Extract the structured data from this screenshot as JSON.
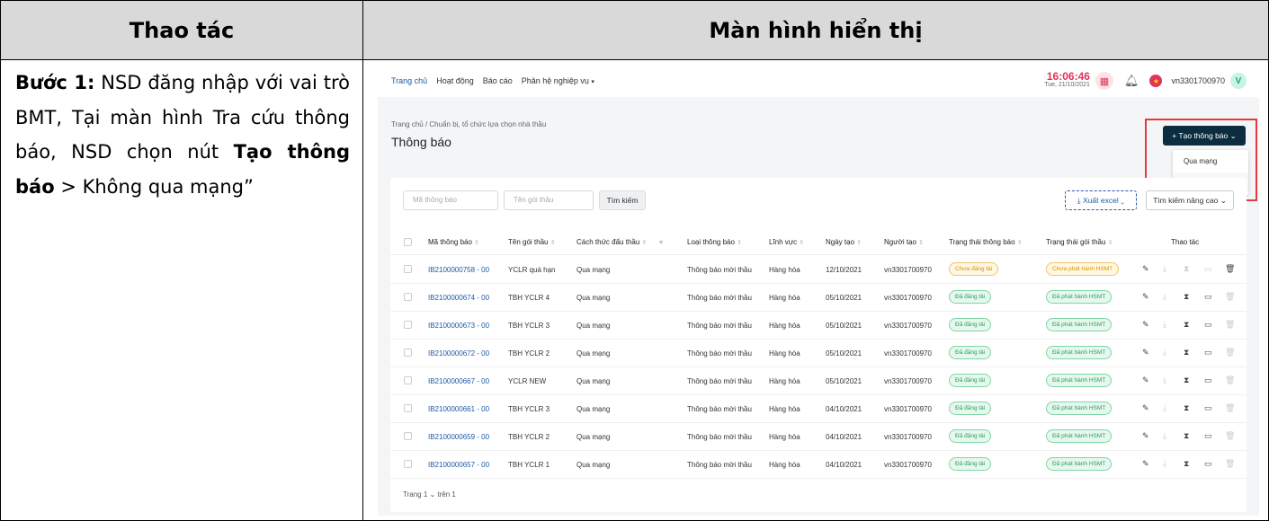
{
  "doc": {
    "col_left_header": "Thao tác",
    "col_right_header": "Màn hình hiển thị",
    "step_label": "Bước 1:",
    "step_text_a": " NSD đăng nhập với vai trò BMT, Tại màn hình Tra cứu thông báo, NSD chọn nút ",
    "step_bold": "Tạo thông báo",
    "step_text_b": " > Không qua mạng”"
  },
  "app": {
    "nav": [
      "Trang chủ",
      "Hoạt động",
      "Báo cáo",
      "Phân hệ nghiệp vụ"
    ],
    "time": "16:06:46",
    "date": "Tue, 21/10/2021",
    "username": "vn3301700970",
    "avatar_letter": "V",
    "breadcrumb": "Trang chủ  /  Chuẩn bị, tổ chức lựa chọn nhà thầu",
    "page_title": "Thông báo",
    "create_button": "+  Tạo thông báo  ⌄",
    "dropdown": [
      "Qua mạng",
      "Không qua mạng"
    ],
    "search_code_placeholder": "Mã thông báo",
    "search_package_placeholder": "Tên gói thầu",
    "search_button": "Tìm kiếm",
    "excel_button": "⤓  Xuất excel  ⌄",
    "advanced_button": "Tìm kiếm nâng cao ⌄",
    "columns": [
      "Mã thông báo",
      "Tên gói thầu",
      "Cách thức đấu thầu",
      "Loại thông báo",
      "Lĩnh vực",
      "Ngày tạo",
      "Người tạo",
      "Trạng thái thông báo",
      "Trạng thái gói thầu",
      "Thao tác"
    ],
    "rows": [
      {
        "code": "IB2100000758 - 00",
        "name": "YCLR quá hạn",
        "method": "Qua mạng",
        "type": "Thông báo mời thầu",
        "field": "Hàng hóa",
        "date": "12/10/2021",
        "creator": "vn3301700970",
        "status": "Chưa đăng tải",
        "pkg_status": "Chưa phát hành HSMT"
      },
      {
        "code": "IB2100000674 - 00",
        "name": "TBH YCLR 4",
        "method": "Qua mạng",
        "type": "Thông báo mời thầu",
        "field": "Hàng hóa",
        "date": "05/10/2021",
        "creator": "vn3301700970",
        "status": "Đã đăng tải",
        "pkg_status": "Đã phát hành HSMT"
      },
      {
        "code": "IB2100000673 - 00",
        "name": "TBH YCLR 3",
        "method": "Qua mạng",
        "type": "Thông báo mời thầu",
        "field": "Hàng hóa",
        "date": "05/10/2021",
        "creator": "vn3301700970",
        "status": "Đã đăng tải",
        "pkg_status": "Đã phát hành HSMT"
      },
      {
        "code": "IB2100000672 - 00",
        "name": "TBH YCLR 2",
        "method": "Qua mạng",
        "type": "Thông báo mời thầu",
        "field": "Hàng hóa",
        "date": "05/10/2021",
        "creator": "vn3301700970",
        "status": "Đã đăng tải",
        "pkg_status": "Đã phát hành HSMT"
      },
      {
        "code": "IB2100000667 - 00",
        "name": "YCLR NEW",
        "method": "Qua mạng",
        "type": "Thông báo mời thầu",
        "field": "Hàng hóa",
        "date": "05/10/2021",
        "creator": "vn3301700970",
        "status": "Đã đăng tải",
        "pkg_status": "Đã phát hành HSMT"
      },
      {
        "code": "IB2100000661 - 00",
        "name": "TBH YCLR 3",
        "method": "Qua mạng",
        "type": "Thông báo mời thầu",
        "field": "Hàng hóa",
        "date": "04/10/2021",
        "creator": "vn3301700970",
        "status": "Đã đăng tải",
        "pkg_status": "Đã phát hành HSMT"
      },
      {
        "code": "IB2100000659 - 00",
        "name": "TBH YCLR 2",
        "method": "Qua mạng",
        "type": "Thông báo mời thầu",
        "field": "Hàng hóa",
        "date": "04/10/2021",
        "creator": "vn3301700970",
        "status": "Đã đăng tải",
        "pkg_status": "Đã phát hành HSMT"
      },
      {
        "code": "IB2100000657 - 00",
        "name": "TBH YCLR 1",
        "method": "Qua mạng",
        "type": "Thông báo mời thầu",
        "field": "Hàng hóa",
        "date": "04/10/2021",
        "creator": "vn3301700970",
        "status": "Đã đăng tải",
        "pkg_status": "Đã phát hành HSMT"
      }
    ],
    "pager": "Trang  1  ⌄  trên 1",
    "icons": {
      "edit": "edit-icon",
      "download": "download-icon",
      "hourglass": "hourglass-icon",
      "card": "card-icon",
      "delete": "trash-icon"
    },
    "colors": {
      "brand_dark": "#0b2d3f",
      "link": "#1d5aa8",
      "alert": "#e0345a",
      "highlight_box": "#e33b3b"
    }
  }
}
